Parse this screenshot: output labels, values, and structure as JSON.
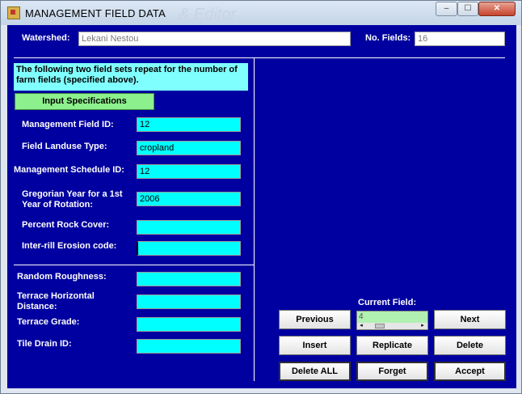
{
  "window": {
    "title": "MANAGEMENT FIELD DATA",
    "minimize_glyph": "–",
    "maximize_glyph": "☐",
    "close_glyph": "✕",
    "watermark": "& Editor"
  },
  "header": {
    "watershed_label": "Watershed:",
    "watershed_value": "Lekani Nestou",
    "num_fields_label": "No. Fields:",
    "num_fields_value": "16"
  },
  "info_text": "The following two field sets repeat for the number of farm fields (specified above).",
  "input_spec_button": "Input Specifications",
  "fields": {
    "management_field_id": {
      "label": "Management Field ID:",
      "value": "12"
    },
    "field_landuse_type": {
      "label": "Field Landuse Type:",
      "value": "cropland"
    },
    "management_schedule_id": {
      "label": "Management Schedule ID:",
      "value": "12"
    },
    "gregorian_year": {
      "label": "Gregorian Year for a 1st Year of Rotation:",
      "value": "2006"
    },
    "percent_rock_cover": {
      "label": "Percent Rock Cover:",
      "value": ""
    },
    "interrill_erosion_code": {
      "label": "Inter-rill Erosion code:",
      "value": ""
    },
    "random_roughness": {
      "label": "Random Roughness:",
      "value": ""
    },
    "terrace_horizontal_distance": {
      "label": "Terrace Horizontal Distance:",
      "value": ""
    },
    "terrace_grade": {
      "label": "Terrace Grade:",
      "value": ""
    },
    "tile_drain_id": {
      "label": "Tile Drain ID:",
      "value": ""
    }
  },
  "navigation": {
    "current_field_label": "Current Field:",
    "current_field_value": "4",
    "previous": "Previous",
    "next": "Next",
    "insert": "Insert",
    "replicate": "Replicate",
    "delete": "Delete",
    "delete_all": "Delete ALL",
    "forget": "Forget",
    "accept": "Accept"
  },
  "colors": {
    "panel_bg": "#0000a0",
    "field_bg": "#00ffff",
    "info_bg": "#80ffff",
    "spec_button_bg": "#8cf08c"
  }
}
